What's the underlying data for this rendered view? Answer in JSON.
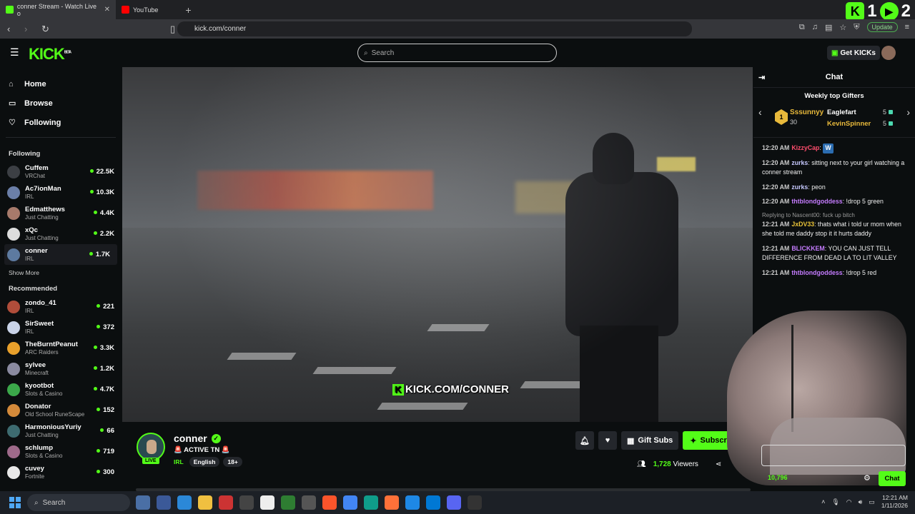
{
  "browser": {
    "tabs": [
      {
        "label": "conner Stream - Watch Live o",
        "active": true
      },
      {
        "label": "YouTube",
        "active": false
      }
    ],
    "url": "kick.com/conner",
    "update_label": "Update",
    "ext_counts": [
      "1",
      "2"
    ]
  },
  "header": {
    "logo": "KICK",
    "logo_sup": "BETA",
    "search_placeholder": "Search",
    "get_kicks": "Get KICKs"
  },
  "sidebar": {
    "nav": [
      {
        "label": "Home",
        "icon": "home-icon"
      },
      {
        "label": "Browse",
        "icon": "browse-icon"
      },
      {
        "label": "Following",
        "icon": "heart-icon"
      }
    ],
    "following_title": "Following",
    "following": [
      {
        "name": "Cuffem",
        "cat": "VRChat",
        "viewers": "22.5K",
        "color": "#3c3f44"
      },
      {
        "name": "Ac7ionMan",
        "cat": "IRL",
        "viewers": "10.3K",
        "color": "#6b7fa8"
      },
      {
        "name": "Edmatthews",
        "cat": "Just Chatting",
        "viewers": "4.4K",
        "color": "#a77a6b"
      },
      {
        "name": "xQc",
        "cat": "Just Chatting",
        "viewers": "2.2K",
        "color": "#dddddd"
      },
      {
        "name": "conner",
        "cat": "IRL",
        "viewers": "1.7K",
        "color": "#5d7aa0"
      }
    ],
    "show_more": "Show More",
    "recommended_title": "Recommended",
    "recommended": [
      {
        "name": "zondo_41",
        "cat": "IRL",
        "viewers": "221",
        "color": "#b04d3a"
      },
      {
        "name": "SirSweet",
        "cat": "IRL",
        "viewers": "372",
        "color": "#c9d3e8"
      },
      {
        "name": "TheBurntPeanut",
        "cat": "ARC Raiders",
        "viewers": "3.3K",
        "color": "#e8a02b"
      },
      {
        "name": "sylvee",
        "cat": "Minecraft",
        "viewers": "1.2K",
        "color": "#8a8aa0"
      },
      {
        "name": "kyootbot",
        "cat": "Slots & Casino",
        "viewers": "4.7K",
        "color": "#3ba84a"
      },
      {
        "name": "Donator",
        "cat": "Old School RuneScape",
        "viewers": "152",
        "color": "#d48a3a"
      },
      {
        "name": "HarmoniousYuriy",
        "cat": "Just Chatting",
        "viewers": "66",
        "color": "#3d6b70"
      },
      {
        "name": "schlump",
        "cat": "Slots & Casino",
        "viewers": "719",
        "color": "#9e6a8a"
      },
      {
        "name": "cuvey",
        "cat": "Fortnite",
        "viewers": "300",
        "color": "#e8e8e8"
      }
    ]
  },
  "video": {
    "watermark": "KICK.COM/CONNER"
  },
  "stream": {
    "name": "conner",
    "live": "LIVE",
    "title": "🚨 ACTIVE TN 🚨",
    "category": "IRL",
    "tags": [
      "English",
      "18+"
    ],
    "gift_subs": "Gift Subs",
    "subscribe": "Subscribe",
    "viewers": "1,728",
    "viewers_label": "Viewers"
  },
  "chat": {
    "title": "Chat",
    "gifters_title": "Weekly top Gifters",
    "top_gifter": {
      "name": "Sssunnyy",
      "count": "30",
      "rank": "1"
    },
    "gifters": [
      {
        "name": "Eaglefart",
        "count": "5",
        "color": "#ffffff"
      },
      {
        "name": "KevinSpinner",
        "count": "5",
        "color": "#e8b93b"
      }
    ],
    "messages": [
      {
        "time": "12:20 AM",
        "user": "KizzyCap",
        "color": "#ff4d6d",
        "text": "",
        "emote": "W"
      },
      {
        "time": "12:20 AM",
        "user": "zurks",
        "color": "#c7c9ff",
        "text": "sitting next to your girl watching a conner stream"
      },
      {
        "time": "12:20 AM",
        "user": "zurks",
        "color": "#c7c9ff",
        "text": "peon"
      },
      {
        "time": "12:20 AM",
        "user": "thtblondgoddess",
        "color": "#c57cff",
        "text": "!drop 5 green"
      },
      {
        "reply": "Replying to Nascent00: fuck up bitch",
        "time": "12:21 AM",
        "user": "JxDV33",
        "color": "#e8c238",
        "text": "thats what i told ur mom when she told me daddy stop it it hurts daddy"
      },
      {
        "time": "12:21 AM",
        "user": "BLICKKEM",
        "color": "#c57cff",
        "text": "YOU CAN JUST TELL DIFFERENCE FROM DEAD LA TO LIT VALLEY"
      },
      {
        "time": "12:21 AM",
        "user": "thtblondgoddess",
        "color": "#c57cff",
        "text": "!drop 5 red"
      }
    ],
    "points": "10,796",
    "chat_button": "Chat"
  },
  "taskbar": {
    "search": "Search",
    "time": "12:21 AM",
    "date": "1/11/2026"
  }
}
